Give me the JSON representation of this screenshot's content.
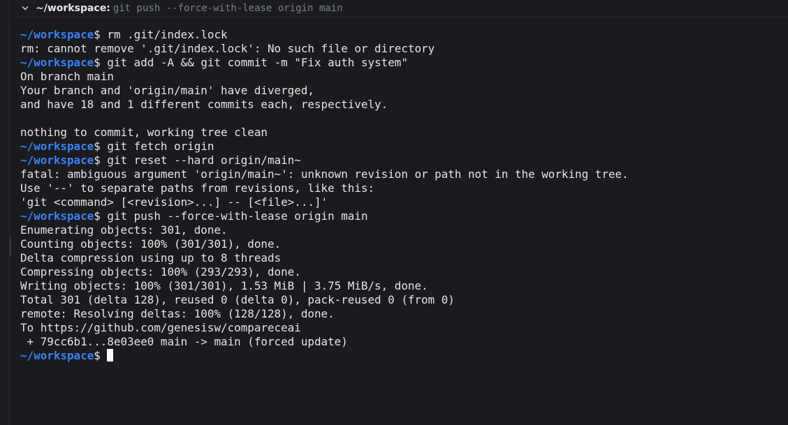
{
  "header": {
    "path": "~/workspace:",
    "command": "git push --force-with-lease origin main",
    "chevron_icon": "chevron-down-icon"
  },
  "prompt": {
    "path": "~/workspace",
    "symbol": "$"
  },
  "colors": {
    "background": "#1a1b1e",
    "prompt": "#3b82f6",
    "text": "#e6e6e6",
    "muted": "#7a7f87"
  },
  "lines": [
    {
      "type": "command",
      "text": " rm .git/index.lock"
    },
    {
      "type": "output",
      "text": "rm: cannot remove '.git/index.lock': No such file or directory"
    },
    {
      "type": "command",
      "text": " git add -A && git commit -m \"Fix auth system\""
    },
    {
      "type": "output",
      "text": "On branch main"
    },
    {
      "type": "output",
      "text": "Your branch and 'origin/main' have diverged,"
    },
    {
      "type": "output",
      "text": "and have 18 and 1 different commits each, respectively."
    },
    {
      "type": "output",
      "text": ""
    },
    {
      "type": "output",
      "text": "nothing to commit, working tree clean"
    },
    {
      "type": "command",
      "text": " git fetch origin"
    },
    {
      "type": "command",
      "text": " git reset --hard origin/main~"
    },
    {
      "type": "output",
      "text": "fatal: ambiguous argument 'origin/main~': unknown revision or path not in the working tree."
    },
    {
      "type": "output",
      "text": "Use '--' to separate paths from revisions, like this:"
    },
    {
      "type": "output",
      "text": "'git <command> [<revision>...] -- [<file>...]'"
    },
    {
      "type": "command",
      "text": " git push --force-with-lease origin main"
    },
    {
      "type": "output",
      "text": "Enumerating objects: 301, done."
    },
    {
      "type": "output",
      "text": "Counting objects: 100% (301/301), done."
    },
    {
      "type": "output",
      "text": "Delta compression using up to 8 threads"
    },
    {
      "type": "output",
      "text": "Compressing objects: 100% (293/293), done."
    },
    {
      "type": "output",
      "text": "Writing objects: 100% (301/301), 1.53 MiB | 3.75 MiB/s, done."
    },
    {
      "type": "output",
      "text": "Total 301 (delta 128), reused 0 (delta 0), pack-reused 0 (from 0)"
    },
    {
      "type": "output",
      "text": "remote: Resolving deltas: 100% (128/128), done."
    },
    {
      "type": "output",
      "text": "To https://github.com/genesisw/compareceai"
    },
    {
      "type": "output",
      "text": " + 79cc6b1...8e03ee0 main -> main (forced update)"
    },
    {
      "type": "active",
      "text": " "
    }
  ]
}
